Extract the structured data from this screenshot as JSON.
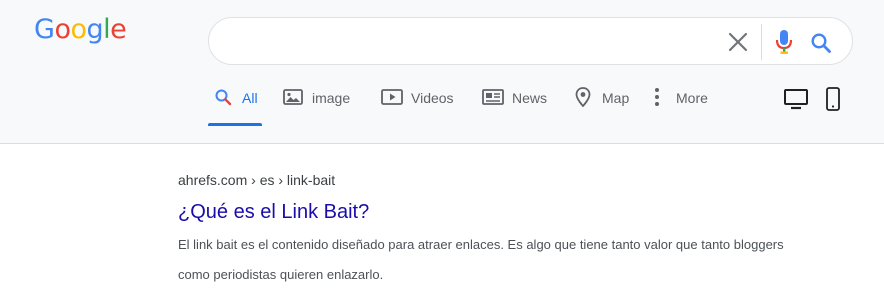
{
  "logo": {
    "letters": [
      "G",
      "o",
      "o",
      "g",
      "l",
      "e"
    ],
    "colors": [
      "#4285f4",
      "#ea4335",
      "#fbbc05",
      "#4285f4",
      "#34a853",
      "#ea4335"
    ]
  },
  "search": {
    "value": "",
    "icons": {
      "clear": "close-icon",
      "voice": "microphone-icon",
      "submit": "search-icon"
    }
  },
  "tabs": [
    {
      "label": "All",
      "icon": "search-icon",
      "active": true
    },
    {
      "label": "image",
      "icon": "image-icon",
      "active": false
    },
    {
      "label": "Videos",
      "icon": "video-icon",
      "active": false
    },
    {
      "label": "News",
      "icon": "news-icon",
      "active": false
    },
    {
      "label": "Map",
      "icon": "map-pin-icon",
      "active": false
    },
    {
      "label": "More",
      "icon": "more-vertical-icon",
      "active": false
    }
  ],
  "device_toggle": {
    "desktop": "desktop-icon",
    "mobile": "mobile-icon"
  },
  "result": {
    "breadcrumb": "ahrefs.com › es › link-bait",
    "title": "¿Qué es el Link Bait?",
    "snippet": "El link bait es el contenido diseñado para atraer enlaces. Es algo que tiene tanto valor que tanto bloggers como periodistas quieren enlazarlo."
  },
  "colors": {
    "accent": "#1a73e8",
    "link": "#1a0dab",
    "header_bg": "#f8f9fa"
  }
}
